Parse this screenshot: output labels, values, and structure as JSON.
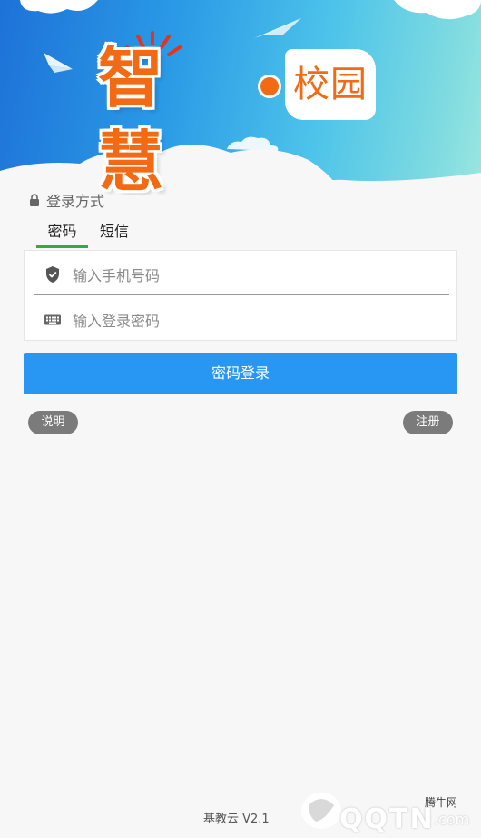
{
  "banner": {
    "logo_main": "智慧",
    "logo_sub": "校园"
  },
  "login": {
    "section_label": "登录方式",
    "tabs": [
      {
        "label": "密码",
        "active": true
      },
      {
        "label": "短信",
        "active": false
      }
    ],
    "phone_placeholder": "输入手机号码",
    "password_placeholder": "输入登录密码",
    "submit_label": "密码登录"
  },
  "links": {
    "help_label": "说明",
    "register_label": "注册"
  },
  "footer": {
    "version": "基教云 V2.1"
  },
  "watermark": {
    "site": "腾牛网",
    "logo_text": "QQTN",
    "domain": ".com"
  },
  "colors": {
    "accent_blue": "#2897f3",
    "tab_indicator": "#36a84a",
    "logo_orange": "#f26a14"
  },
  "icons": {
    "lock": "lock-icon",
    "phone_field": "shield-check-icon",
    "password_field": "keyboard-icon"
  }
}
